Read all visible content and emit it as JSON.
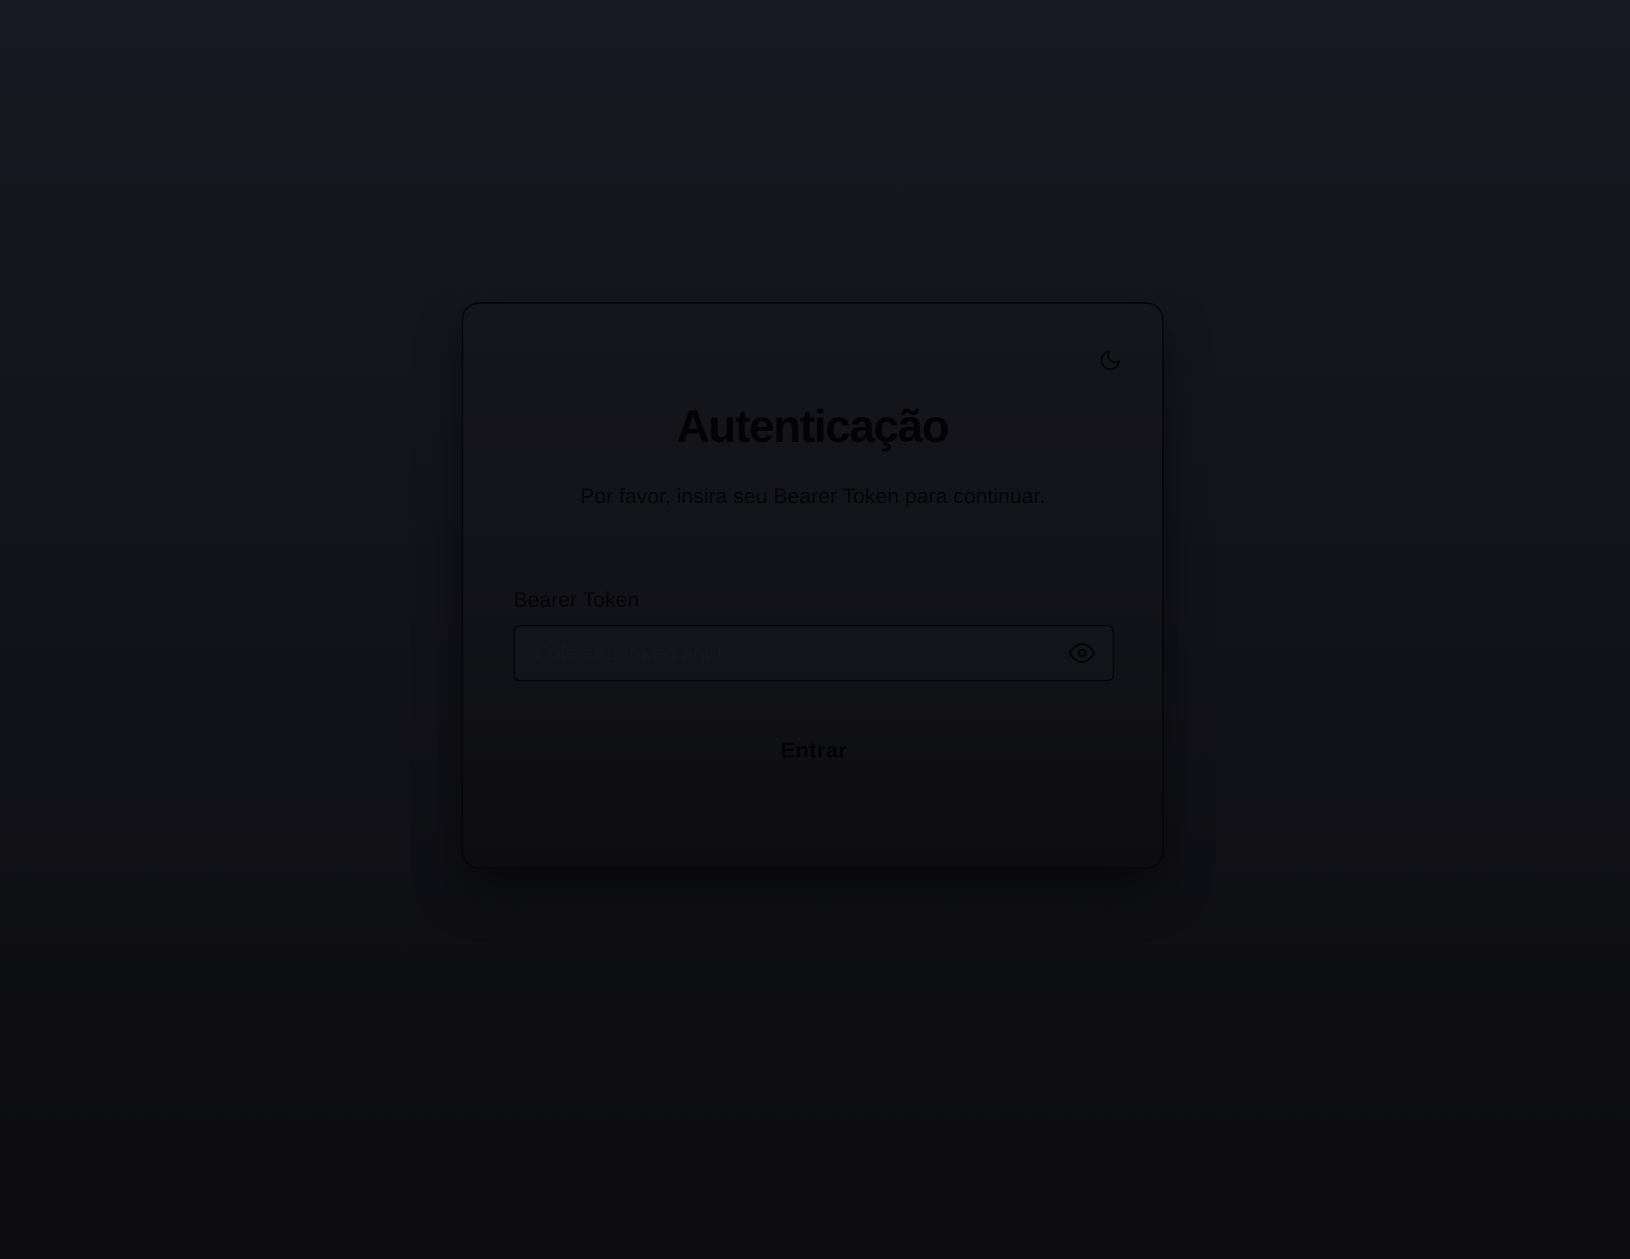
{
  "auth": {
    "title": "Autenticação",
    "subtitle": "Por favor, insira seu Bearer Token para continuar.",
    "token_label": "Bearer Token",
    "token_placeholder": "Cole seu token aqui...",
    "token_value": "",
    "submit_label": "Entrar"
  },
  "icons": {
    "theme_toggle": "moon-icon",
    "password_visibility": "eye-icon"
  },
  "colors": {
    "background_top": "#171922",
    "background_bottom": "#0c0c0e",
    "card": "#131419",
    "text": "#040405"
  }
}
